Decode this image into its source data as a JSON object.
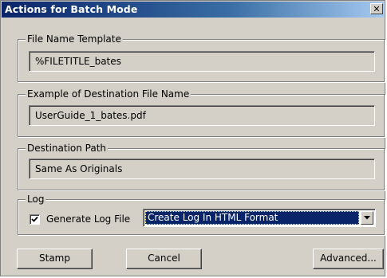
{
  "window": {
    "title": "Actions for Batch Mode",
    "close_glyph": "✕"
  },
  "file_name_template": {
    "legend": "File Name Template",
    "value": "%FILETITLE_bates"
  },
  "example_destination": {
    "legend": "Example of Destination File Name",
    "value": "UserGuide_1_bates.pdf"
  },
  "destination_path": {
    "legend": "Destination Path",
    "value": "Same As Originals"
  },
  "log": {
    "legend": "Log",
    "generate_label": "Generate Log File",
    "generate_checked": true,
    "format_selected": "Create Log In HTML Format"
  },
  "buttons": {
    "stamp": "Stamp",
    "cancel": "Cancel",
    "advanced": "Advanced..."
  },
  "colors": {
    "dialog_bg": "#d4d0c8",
    "titlebar_start": "#0a246a",
    "selection": "#0a246a"
  },
  "icons": {
    "close": "close-icon",
    "checkmark": "checkmark-icon",
    "dropdown": "chevron-down-icon"
  }
}
